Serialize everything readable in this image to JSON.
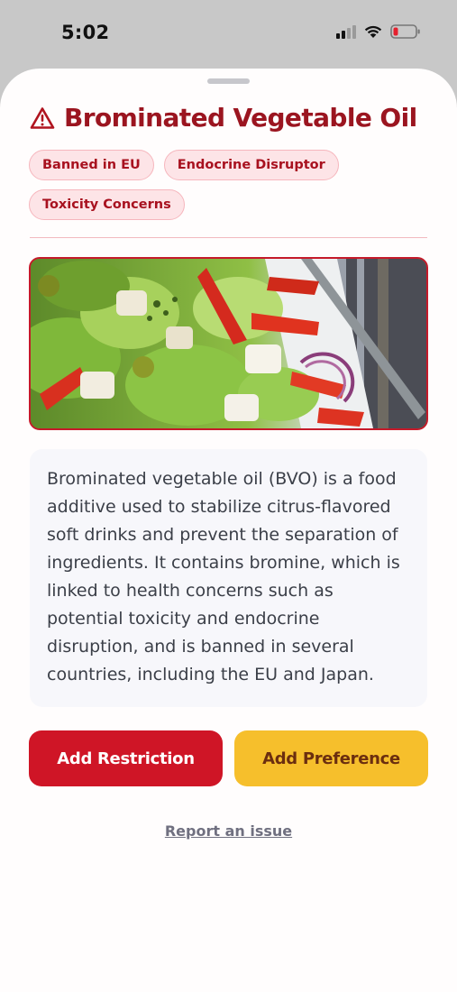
{
  "status_bar": {
    "time": "5:02",
    "icons": [
      "cellular-signal-icon",
      "wifi-icon",
      "battery-low-icon"
    ]
  },
  "sheet": {
    "title": "Brominated Vegetable Oil",
    "title_icon": "warning-triangle-icon",
    "tags": [
      {
        "label": "Banned in EU"
      },
      {
        "label": "Endocrine Disruptor"
      },
      {
        "label": "Toxicity Concerns"
      }
    ],
    "image_alt_subject": "salad-photo",
    "description": "Brominated vegetable oil (BVO) is a food additive used to stabilize citrus-flavored soft drinks and prevent the separation of ingredients. It contains bromine, which is linked to health concerns such as potential toxicity and endocrine disruption, and is banned in several countries, including the EU and Japan.",
    "buttons": {
      "restriction": "Add Restriction",
      "preference": "Add Preference"
    },
    "report_link": "Report an issue"
  },
  "colors": {
    "title": "#9b1520",
    "tag_bg": "#fde4e7",
    "tag_text": "#a8111f",
    "restriction_btn": "#cf1526",
    "preference_btn": "#f6bf2c",
    "preference_text": "#6b2e0f",
    "battery_level": "#e5202e"
  }
}
